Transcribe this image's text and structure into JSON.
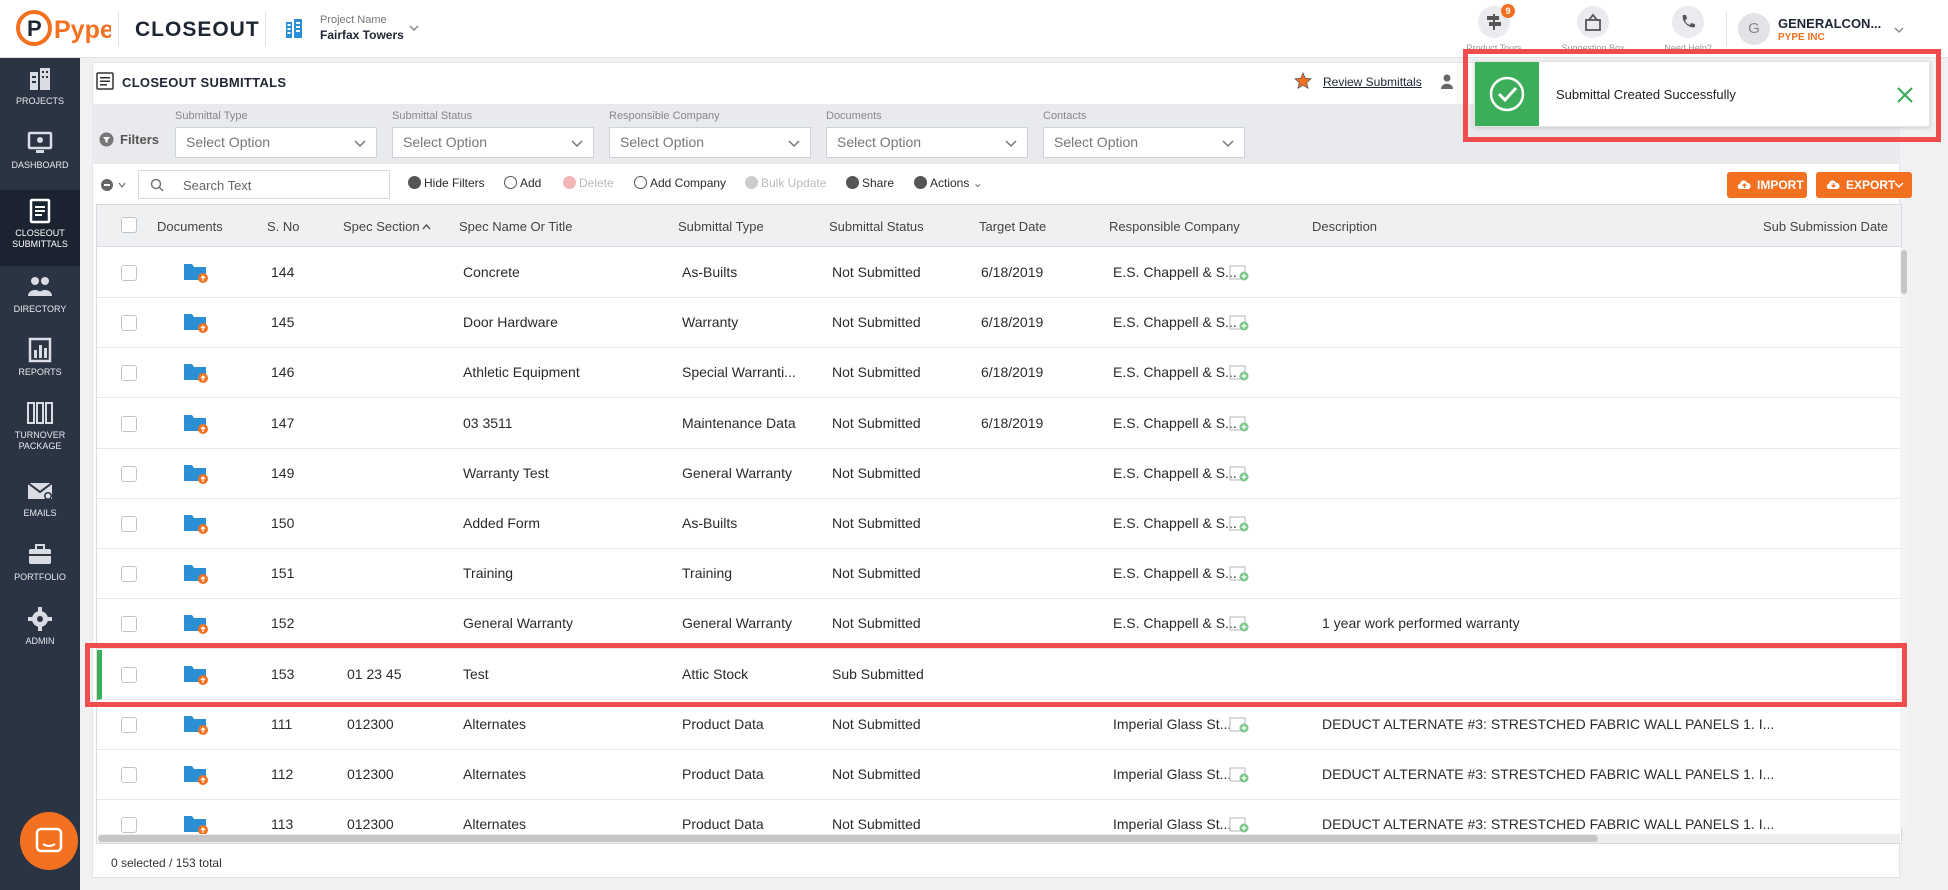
{
  "header": {
    "logo": "Pype",
    "app_title": "CLOSEOUT",
    "project_label": "Project Name",
    "project_name": "Fairfax Towers",
    "product_tours_badge": "9",
    "product_tours": "Product Tours",
    "suggestion_box": "Suggestion Box",
    "need_help": "Need Help?",
    "user_initial": "G",
    "user_name": "GENERALCON...",
    "user_company": "PYPE INC"
  },
  "sidebar": {
    "items": [
      {
        "label": "PROJECTS",
        "icon": "building-icon"
      },
      {
        "label": "DASHBOARD",
        "icon": "monitor-icon"
      },
      {
        "label": "CLOSEOUT SUBMITTALS",
        "icon": "document-icon"
      },
      {
        "label": "DIRECTORY",
        "icon": "people-icon"
      },
      {
        "label": "REPORTS",
        "icon": "chart-icon"
      },
      {
        "label": "TURNOVER PACKAGE",
        "icon": "binders-icon"
      },
      {
        "label": "EMAILS",
        "icon": "envelope-icon"
      },
      {
        "label": "PORTFOLIO",
        "icon": "briefcase-icon"
      },
      {
        "label": "ADMIN",
        "icon": "gear-icon"
      }
    ],
    "active_index": 2
  },
  "page": {
    "title": "CLOSEOUT SUBMITTALS",
    "review_link": "Review Submittals"
  },
  "filters": {
    "label": "Filters",
    "fields": [
      {
        "label": "Submittal Type",
        "value": "Select Option"
      },
      {
        "label": "Submittal Status",
        "value": "Select Option"
      },
      {
        "label": "Responsible Company",
        "value": "Select Option"
      },
      {
        "label": "Documents",
        "value": "Select Option"
      },
      {
        "label": "Contacts",
        "value": "Select Option"
      }
    ]
  },
  "toolbar": {
    "search_placeholder": "Search Text",
    "hide_filters": "Hide Filters",
    "add": "Add",
    "delete": "Delete",
    "add_company": "Add Company",
    "bulk_update": "Bulk Update",
    "share": "Share",
    "actions": "Actions",
    "import": "IMPORT",
    "export": "EXPORT"
  },
  "table": {
    "columns": [
      "Documents",
      "S. No",
      "Spec Section",
      "Spec Name Or Title",
      "Submittal Type",
      "Submittal Status",
      "Target Date",
      "Responsible Company",
      "Description",
      "Sub Submission Date"
    ],
    "rows": [
      {
        "sno": "144",
        "spec": "",
        "name": "Concrete",
        "type": "As-Builts",
        "status": "Not Submitted",
        "date": "6/18/2019",
        "company": "E.S. Chappell & S...",
        "desc": ""
      },
      {
        "sno": "145",
        "spec": "",
        "name": "Door Hardware",
        "type": "Warranty",
        "status": "Not Submitted",
        "date": "6/18/2019",
        "company": "E.S. Chappell & S...",
        "desc": ""
      },
      {
        "sno": "146",
        "spec": "",
        "name": "Athletic Equipment",
        "type": "Special Warranti...",
        "status": "Not Submitted",
        "date": "6/18/2019",
        "company": "E.S. Chappell & S...",
        "desc": ""
      },
      {
        "sno": "147",
        "spec": "",
        "name": "03 3511",
        "type": "Maintenance Data",
        "status": "Not Submitted",
        "date": "6/18/2019",
        "company": "E.S. Chappell & S...",
        "desc": ""
      },
      {
        "sno": "149",
        "spec": "",
        "name": "Warranty Test",
        "type": "General Warranty",
        "status": "Not Submitted",
        "date": "",
        "company": "E.S. Chappell & S...",
        "desc": ""
      },
      {
        "sno": "150",
        "spec": "",
        "name": "Added Form",
        "type": "As-Builts",
        "status": "Not Submitted",
        "date": "",
        "company": "E.S. Chappell & S...",
        "desc": ""
      },
      {
        "sno": "151",
        "spec": "",
        "name": "Training",
        "type": "Training",
        "status": "Not Submitted",
        "date": "",
        "company": "E.S. Chappell & S...",
        "desc": ""
      },
      {
        "sno": "152",
        "spec": "",
        "name": "General Warranty",
        "type": "General Warranty",
        "status": "Not Submitted",
        "date": "",
        "company": "E.S. Chappell & S...",
        "desc": "1 year work performed warranty"
      },
      {
        "sno": "153",
        "spec": "01 23 45",
        "name": "Test",
        "type": "Attic Stock",
        "status": "Sub Submitted",
        "date": "",
        "company": "",
        "desc": ""
      },
      {
        "sno": "111",
        "spec": "012300",
        "name": "Alternates",
        "type": "Product Data",
        "status": "Not Submitted",
        "date": "",
        "company": "Imperial Glass St...",
        "desc": "DEDUCT ALTERNATE #3: STRESTCHED FABRIC WALL PANELS 1. I..."
      },
      {
        "sno": "112",
        "spec": "012300",
        "name": "Alternates",
        "type": "Product Data",
        "status": "Not Submitted",
        "date": "",
        "company": "Imperial Glass St...",
        "desc": "DEDUCT ALTERNATE #3: STRESTCHED FABRIC WALL PANELS 1. I..."
      },
      {
        "sno": "113",
        "spec": "012300",
        "name": "Alternates",
        "type": "Product Data",
        "status": "Not Submitted",
        "date": "",
        "company": "Imperial Glass St...",
        "desc": "DEDUCT ALTERNATE #3: STRESTCHED FABRIC WALL PANELS 1. I..."
      }
    ],
    "footer": "0 selected / 153 total"
  },
  "toast": {
    "message": "Submittal Created Successfully"
  },
  "colors": {
    "accent": "#f37021",
    "sidebar": "#2b3443",
    "success": "#3cae5a",
    "highlight": "#ef4d4d"
  }
}
